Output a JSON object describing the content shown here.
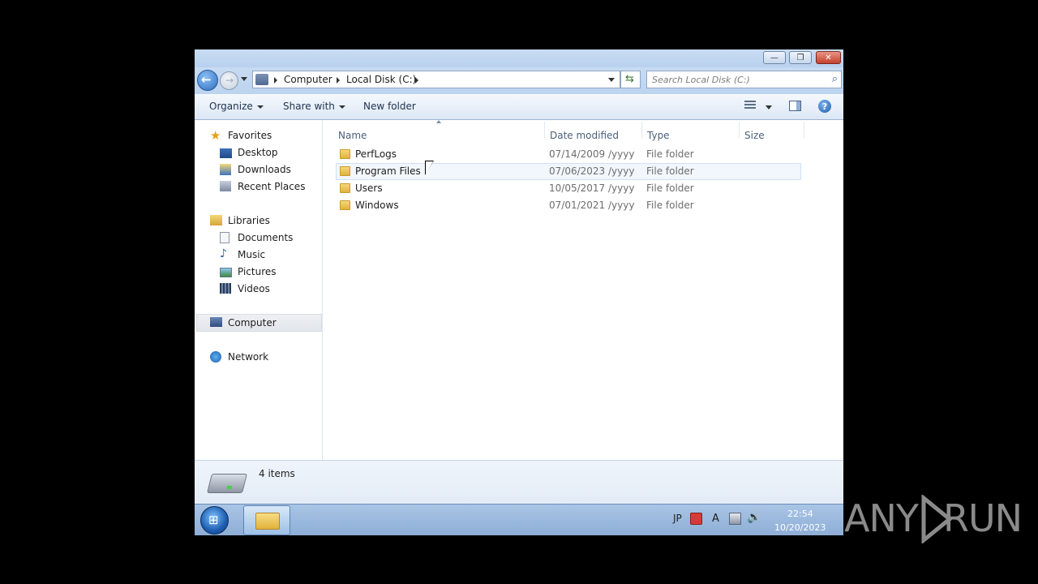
{
  "window": {
    "title_buttons": {
      "minimize": "—",
      "maximize": "❐",
      "close": "✕"
    }
  },
  "nav": {
    "back_icon": "back-arrow-icon",
    "forward_icon": "forward-arrow-icon",
    "breadcrumb": [
      "Computer",
      "Local Disk (C:)"
    ],
    "search_placeholder": "Search Local Disk (C:)"
  },
  "toolbar": {
    "organize_label": "Organize",
    "share_label": "Share with",
    "new_folder_label": "New folder"
  },
  "navpane": {
    "favorites": "Favorites",
    "desktop": "Desktop",
    "downloads": "Downloads",
    "recent": "Recent Places",
    "libraries": "Libraries",
    "documents": "Documents",
    "music": "Music",
    "pictures": "Pictures",
    "videos": "Videos",
    "computer": "Computer",
    "network": "Network"
  },
  "filelist": {
    "columns": {
      "name": "Name",
      "date": "Date modified",
      "type": "Type",
      "size": "Size"
    },
    "rows": [
      {
        "name": "PerfLogs",
        "date": "07/14/2009 /yyyy",
        "type": "File folder"
      },
      {
        "name": "Program Files",
        "date": "07/06/2023 /yyyy",
        "type": "File folder"
      },
      {
        "name": "Users",
        "date": "10/05/2017 /yyyy",
        "type": "File folder"
      },
      {
        "name": "Windows",
        "date": "07/01/2021 /yyyy",
        "type": "File folder"
      }
    ]
  },
  "details": {
    "items_count": "4 items"
  },
  "taskbar": {
    "lang": "JP",
    "ime": "A",
    "time": "22:54",
    "date": "10/20/2023"
  },
  "watermark": {
    "left": "ANY",
    "right": "RUN"
  }
}
